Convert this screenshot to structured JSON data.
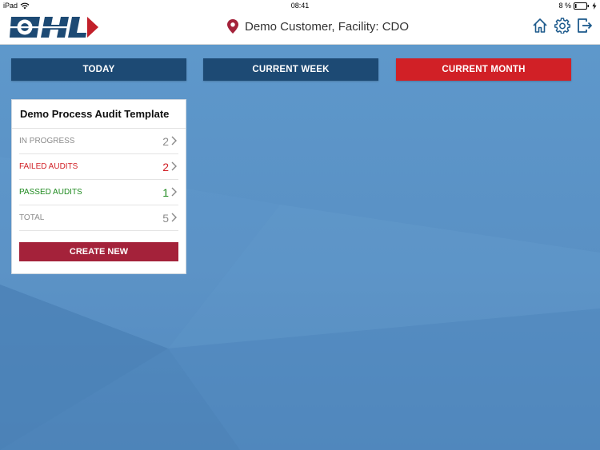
{
  "status_bar": {
    "device": "iPad",
    "time": "08:41",
    "battery": "8 %"
  },
  "header": {
    "location": "Demo Customer, Facility: CDO"
  },
  "colors": {
    "tab_inactive": "#1d4a74",
    "tab_active": "#d12026",
    "in_progress": "#8c8c8c",
    "failed": "#d12026",
    "passed": "#1f8a1f",
    "total": "#8c8c8c",
    "create_button": "#a4223a"
  },
  "tabs": [
    {
      "label": "TODAY",
      "active": false
    },
    {
      "label": "CURRENT WEEK",
      "active": false
    },
    {
      "label": "CURRENT MONTH",
      "active": true
    }
  ],
  "card": {
    "title": "Demo Process Audit Template",
    "rows": [
      {
        "label": "IN PROGRESS",
        "count": "2"
      },
      {
        "label": "FAILED AUDITS",
        "count": "2"
      },
      {
        "label": "PASSED AUDITS",
        "count": "1"
      },
      {
        "label": "TOTAL",
        "count": "5"
      }
    ],
    "create_label": "CREATE NEW"
  }
}
